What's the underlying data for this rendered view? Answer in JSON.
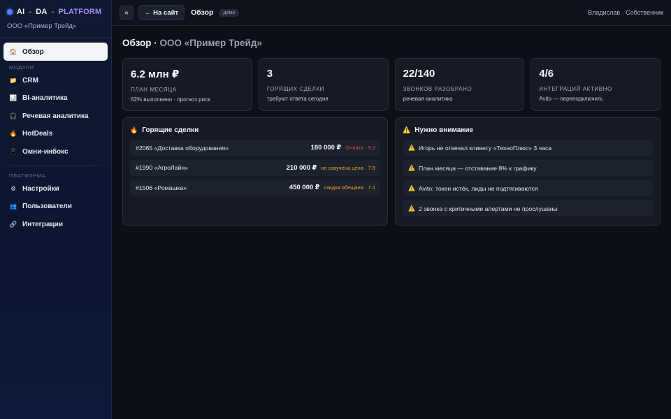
{
  "brand": {
    "part1": "AI",
    "sep": "-",
    "part2": "DA",
    "part3": "PLATFORM",
    "company": "ООО «Пример Трейд»"
  },
  "sidebar": {
    "overview": {
      "label": "Обзор",
      "icon": "house-icon"
    },
    "section_modules": "МОДУЛИ",
    "modules": [
      {
        "label": "CRM",
        "icon": "folder-icon",
        "glyph": "📁"
      },
      {
        "label": "BI-аналитика",
        "icon": "bar-chart-icon",
        "glyph": "📊"
      },
      {
        "label": "Речевая аналитика",
        "icon": "headphones-icon",
        "glyph": "🎧"
      },
      {
        "label": "HotDeals",
        "icon": "fire-icon",
        "glyph": "🔥"
      },
      {
        "label": "Омни-инбокс",
        "icon": "phone-icon",
        "glyph": "📱"
      }
    ],
    "section_platform": "ПЛАТФОРМА",
    "platform": [
      {
        "label": "Настройки",
        "icon": "gear-icon",
        "glyph": "⚙"
      },
      {
        "label": "Пользователи",
        "icon": "users-icon",
        "glyph": "👥"
      },
      {
        "label": "Интеграции",
        "icon": "link-icon",
        "glyph": "🔗"
      }
    ]
  },
  "topbar": {
    "collapse_label": "«",
    "back_label": "← На сайт",
    "title": "Обзор",
    "badge": "демо",
    "user": "Владислав · Собственник"
  },
  "main": {
    "heading": "Обзор",
    "heading_sep": " · ",
    "heading_company": "ООО «Пример Трейд»",
    "stats": [
      {
        "value": "6.2 млн ₽",
        "label": "ПЛАН МЕСЯЦА",
        "sub": "62% выполнено · прогноз риск"
      },
      {
        "value": "3",
        "label": "ГОРЯЩИХ СДЕЛКИ",
        "sub": "требуют ответа сегодня"
      },
      {
        "value": "22/140",
        "label": "ЗВОНКОВ РАЗОБРАНО",
        "sub": "речевая аналитика"
      },
      {
        "value": "4/6",
        "label": "ИНТЕГРАЦИЙ АКТИВНО",
        "sub": "Avito — переподключить"
      }
    ],
    "deals_panel": {
      "title": "Горящие сделки",
      "deals": [
        {
          "name": "#2065 «Доставка оборудования»",
          "amount": "180 000 ₽",
          "note": "Оплата · 9.2",
          "note_color": "#e5533d"
        },
        {
          "name": "#1990 «АгроЛайн»",
          "amount": "210 000 ₽",
          "note": "не озвучена цена · 7.8",
          "note_color": "#f0a030"
        },
        {
          "name": "#1506 «Ромашка»",
          "amount": "450 000 ₽",
          "note": "скидка обещана · 7.1",
          "note_color": "#f0a030"
        }
      ]
    },
    "attention_panel": {
      "title": "Нужно внимание",
      "alerts": [
        "Игорь не отвечал клиенту «ТехноПлюс» 3 часа",
        "План месяца — отставание 8% к графику",
        "Avito: токен истёк, лиды не подтягиваются",
        "2 звонка с критичными алертами не прослушаны"
      ]
    }
  }
}
